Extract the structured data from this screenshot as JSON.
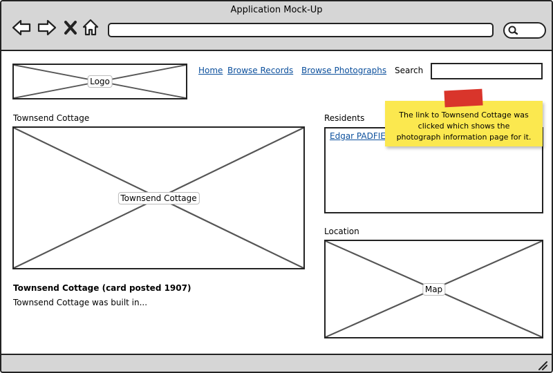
{
  "window": {
    "title": "Application Mock-Up"
  },
  "browser": {
    "icons": [
      "back-arrow-icon",
      "forward-arrow-icon",
      "close-x-icon",
      "home-icon",
      "search-icon"
    ]
  },
  "header": {
    "logo_label": "Logo",
    "nav": [
      "Home",
      "Browse Records",
      "Browse Photographs"
    ],
    "search_label": "Search"
  },
  "main": {
    "section_title": "Townsend Cottage",
    "image_label": "Townsend Cottage",
    "caption_title": "Townsend Cottage (card posted 1907)",
    "caption_text": "Townsend Cottage was built in..."
  },
  "sidebar": {
    "residents_label": "Residents",
    "residents": [
      "Edgar PADFIELD"
    ],
    "location_label": "Location",
    "map_label": "Map"
  },
  "sticky_note": {
    "lines": [
      "The link to Townsend Cottage was",
      "clicked which shows the",
      "photograph information page for it."
    ]
  },
  "colors": {
    "chrome": "#d6d6d6",
    "link": "#0b4f9c",
    "note": "#fbe84f",
    "tape": "#d9352b"
  }
}
